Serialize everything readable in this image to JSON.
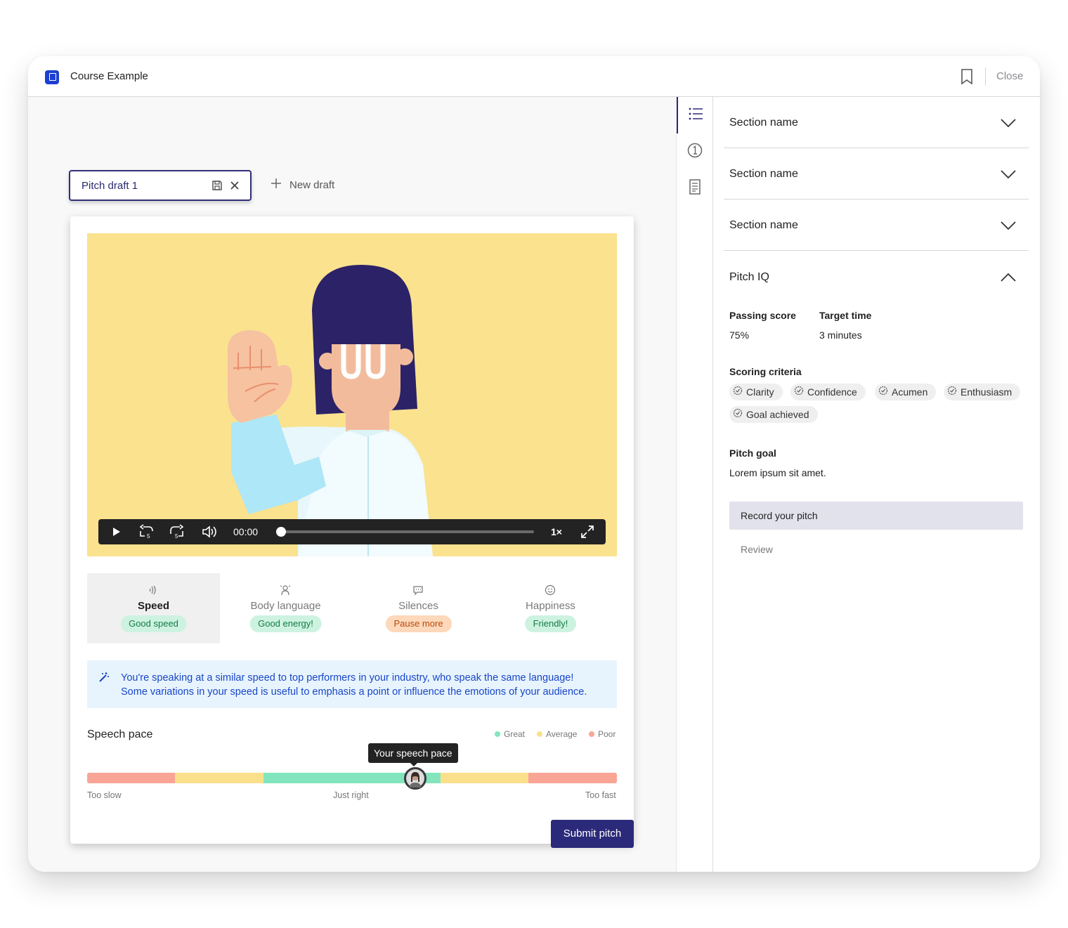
{
  "app": {
    "title": "Course Example",
    "close_label": "Close"
  },
  "drafts": {
    "active": "Pitch draft 1",
    "new_label": "New draft"
  },
  "player": {
    "time": "00:00",
    "rate": "1×",
    "progress": 0
  },
  "metrics": [
    {
      "name": "Speed",
      "badge": "Good speed",
      "badge_status": "good",
      "icon": "speed-icon"
    },
    {
      "name": "Body language",
      "badge": "Good energy!",
      "badge_status": "good",
      "icon": "body-language-icon"
    },
    {
      "name": "Silences",
      "badge": "Pause more",
      "badge_status": "warn",
      "icon": "chat-icon"
    },
    {
      "name": "Happiness",
      "badge": "Friendly!",
      "badge_status": "good",
      "icon": "smile-icon"
    }
  ],
  "insight": {
    "line1": "You're speaking at a similar speed to top performers in your industry, who speak the same language!",
    "line2": "Some variations in your speed is useful to emphasis a point or influence the emotions of your audience."
  },
  "pace": {
    "title": "Speech pace",
    "legend": [
      {
        "label": "Great",
        "color": "#83e5bd"
      },
      {
        "label": "Average",
        "color": "#fbe08c"
      },
      {
        "label": "Poor",
        "color": "#f9a596"
      }
    ],
    "tooltip": "Your speech pace",
    "axis": {
      "left": "Too slow",
      "center": "Just right",
      "right": "Too fast"
    },
    "value_fraction": 0.62
  },
  "submit_label": "Submit pitch",
  "sidebar": {
    "sections": [
      "Section name",
      "Section name",
      "Section name"
    ],
    "pitch_iq": {
      "title": "Pitch IQ",
      "passing_score_label": "Passing score",
      "passing_score": "75%",
      "target_time_label": "Target time",
      "target_time": "3 minutes",
      "criteria_label": "Scoring criteria",
      "criteria": [
        "Clarity",
        "Confidence",
        "Acumen",
        "Enthusiasm",
        "Goal achieved"
      ],
      "goal_label": "Pitch goal",
      "goal": "Lorem ipsum sit amet."
    },
    "steps": [
      {
        "label": "Record your pitch",
        "active": true
      },
      {
        "label": "Review",
        "active": false
      }
    ]
  },
  "colors": {
    "brand": "#2b2a7a",
    "video_bg": "#fbe28f",
    "insight_text": "#1846c9"
  }
}
